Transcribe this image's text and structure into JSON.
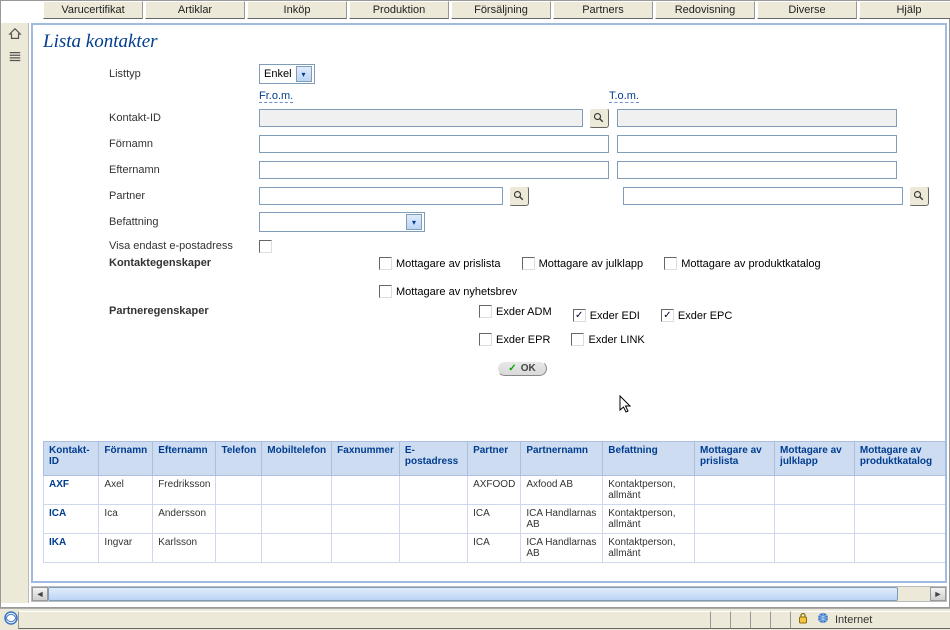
{
  "tabs": [
    "Varucertifikat",
    "Artiklar",
    "Inköp",
    "Produktion",
    "Försäljning",
    "Partners",
    "Redovisning",
    "Diverse",
    "Hjälp"
  ],
  "title": "Lista kontakter",
  "form": {
    "listtyp_label": "Listtyp",
    "listtyp_value": "Enkel",
    "from_label": "Fr.o.m.",
    "to_label": "T.o.m.",
    "kontakt_id_label": "Kontakt-ID",
    "fornamn_label": "Förnamn",
    "efternamn_label": "Efternamn",
    "partner_label": "Partner",
    "befattning_label": "Befattning",
    "visa_epost_label": "Visa endast e-postadress",
    "kontaktegenskaper_label": "Kontaktegenskaper",
    "partneregenskaper_label": "Partneregenskaper"
  },
  "kontakt_props": [
    {
      "label": "Mottagare av prislista",
      "checked": false
    },
    {
      "label": "Mottagare av julklapp",
      "checked": false
    },
    {
      "label": "Mottagare av produktkatalog",
      "checked": false
    },
    {
      "label": "Mottagare av nyhetsbrev",
      "checked": false
    }
  ],
  "partner_props": [
    {
      "label": "Exder ADM",
      "checked": false
    },
    {
      "label": "Exder EDI",
      "checked": true
    },
    {
      "label": "Exder EPC",
      "checked": true
    },
    {
      "label": "Exder EPR",
      "checked": false
    },
    {
      "label": "Exder LINK",
      "checked": false
    }
  ],
  "ok_label": "OK",
  "table": {
    "headers": [
      "Kontakt-ID",
      "Förnamn",
      "Efternamn",
      "Telefon",
      "Mobiltelefon",
      "Faxnummer",
      "E-postadress",
      "Partner",
      "Partnernamn",
      "Befattning",
      "Mottagare av prislista",
      "Mottagare av julklapp",
      "Mottagare av produktkatalog"
    ],
    "rows": [
      {
        "id": "AXF",
        "fn": "Axel",
        "ln": "Fredriksson",
        "tel": "",
        "mob": "",
        "fax": "",
        "mail": "",
        "partner": "AXFOOD",
        "pname": "Axfood AB",
        "bef": "Kontaktperson, allmänt"
      },
      {
        "id": "ICA",
        "fn": "Ica",
        "ln": "Andersson",
        "tel": "",
        "mob": "",
        "fax": "",
        "mail": "",
        "partner": "ICA",
        "pname": "ICA Handlarnas AB",
        "bef": "Kontaktperson, allmänt"
      },
      {
        "id": "IKA",
        "fn": "Ingvar",
        "ln": "Karlsson",
        "tel": "",
        "mob": "",
        "fax": "",
        "mail": "",
        "partner": "ICA",
        "pname": "ICA Handlarnas AB",
        "bef": "Kontaktperson, allmänt"
      }
    ]
  },
  "status": {
    "internet": "Internet"
  }
}
